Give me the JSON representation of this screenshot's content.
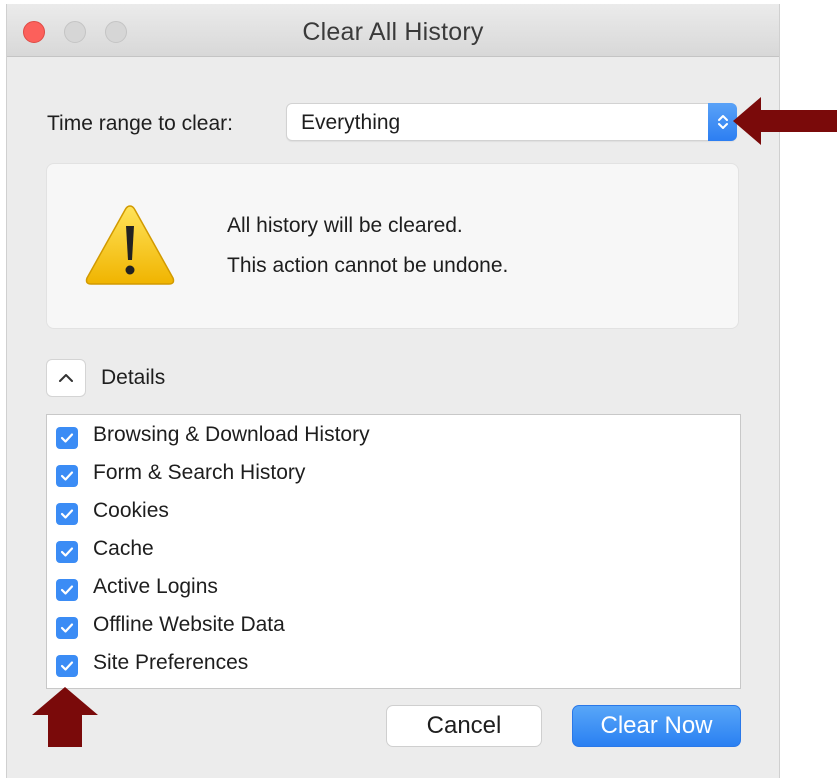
{
  "window": {
    "title": "Clear All History"
  },
  "time_range": {
    "label": "Time range to clear:",
    "selected": "Everything"
  },
  "warning": {
    "line1": "All history will be cleared.",
    "line2": "This action cannot be undone."
  },
  "details": {
    "label": "Details",
    "items": [
      {
        "label": "Browsing & Download History",
        "checked": true
      },
      {
        "label": "Form & Search History",
        "checked": true
      },
      {
        "label": "Cookies",
        "checked": true
      },
      {
        "label": "Cache",
        "checked": true
      },
      {
        "label": "Active Logins",
        "checked": true
      },
      {
        "label": "Offline Website Data",
        "checked": true
      },
      {
        "label": "Site Preferences",
        "checked": true
      }
    ]
  },
  "buttons": {
    "cancel": "Cancel",
    "clear_now": "Clear Now"
  },
  "colors": {
    "accent": "#2c7ef2",
    "annotation_arrow": "#7a0a0a",
    "close_light": "#fc605b",
    "warning_yellow": "#f5c400"
  }
}
